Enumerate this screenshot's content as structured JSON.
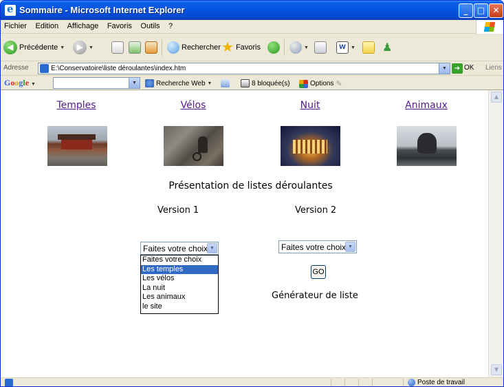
{
  "window": {
    "title": "Sommaire - Microsoft Internet Explorer"
  },
  "menu": [
    "Fichier",
    "Edition",
    "Affichage",
    "Favoris",
    "Outils",
    "?"
  ],
  "toolbar": {
    "back_label": "Précédente",
    "search_label": "Rechercher",
    "favorites_label": "Favoris"
  },
  "address": {
    "label": "Adresse",
    "url": "E:\\Conservatoire\\liste déroulantes\\index.htm",
    "go_label": "OK",
    "links_label": "Liens"
  },
  "googlebar": {
    "web_search_label": "Recherche Web",
    "blocked_label": "8 bloquée(s)",
    "options_label": "Options"
  },
  "page": {
    "nav": [
      "Temples",
      "Vélos",
      "Nuit",
      "Animaux"
    ],
    "heading": "Présentation de listes déroulantes",
    "version1": "Version 1",
    "version2": "Version 2",
    "select1_value": "Faites votre choix",
    "select2_value": "Faites votre choix",
    "options": [
      "Faites votre choix",
      "Les temples",
      "Les vélos",
      "La nuit",
      "Les animaux",
      "le site"
    ],
    "selected_option": "Les temples",
    "go_button": "GO",
    "generator_label": "Générateur de liste"
  },
  "status": {
    "zone_label": "Poste de travail"
  }
}
